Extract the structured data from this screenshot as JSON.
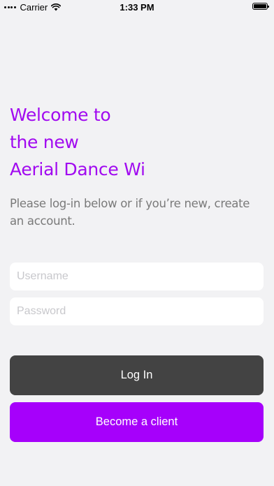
{
  "status_bar": {
    "carrier": "Carrier",
    "time": "1:33 PM"
  },
  "welcome": {
    "line1": "Welcome to",
    "line2": "the new",
    "line3": "Aerial Dance Wi"
  },
  "subtitle": "Please log-in below or if you’re new, create an account.",
  "form": {
    "username_placeholder": "Username",
    "password_placeholder": "Password"
  },
  "buttons": {
    "login_label": "Log In",
    "become_client_label": "Become a client"
  },
  "colors": {
    "accent": "#a600fb",
    "title": "#a10af0",
    "login_button": "#434343",
    "background": "#f2f2f4"
  }
}
